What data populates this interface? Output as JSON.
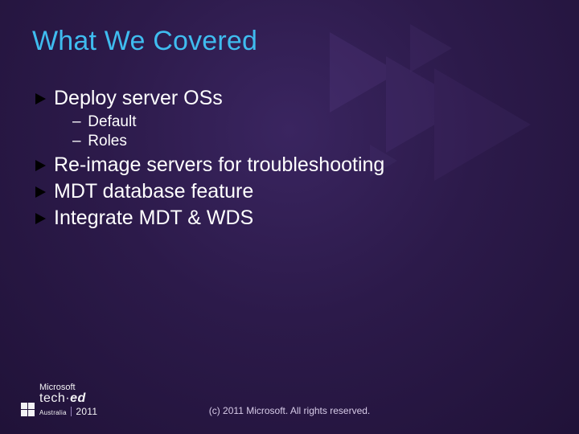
{
  "title": "What We Covered",
  "bullets": [
    {
      "level": 1,
      "text": "Deploy server OSs"
    },
    {
      "level": 2,
      "text": "Default"
    },
    {
      "level": 2,
      "text": "Roles"
    },
    {
      "level": 1,
      "text": "Re-image servers for troubleshooting"
    },
    {
      "level": 1,
      "text": "MDT database feature"
    },
    {
      "level": 1,
      "text": "Integrate MDT & WDS"
    }
  ],
  "footer": {
    "copyright": "(c) 2011 Microsoft. All rights reserved."
  },
  "logo": {
    "brand": "Microsoft",
    "product_a": "tech",
    "product_b": "ed",
    "region": "Australia",
    "year": "2011"
  }
}
